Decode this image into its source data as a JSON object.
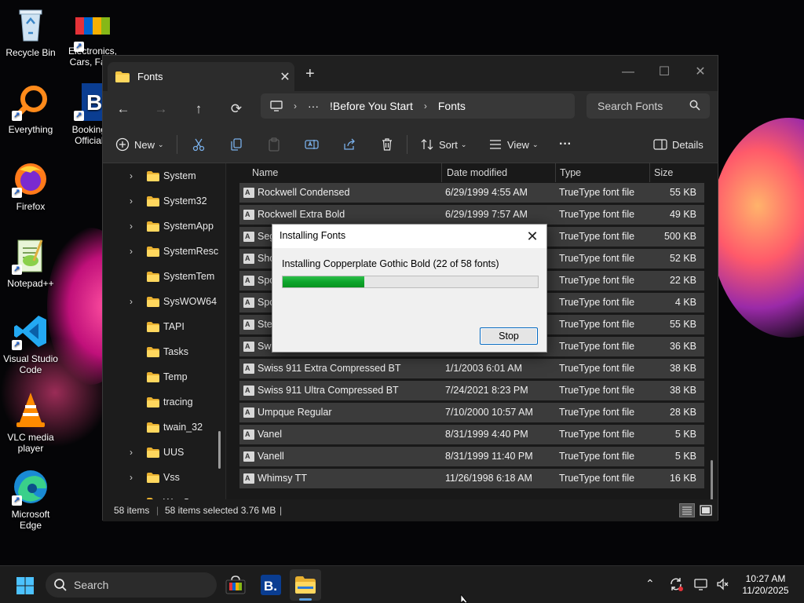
{
  "desktop": {
    "icons": [
      {
        "label": "Recycle Bin"
      },
      {
        "label": "Electronics, Cars, Fash"
      },
      {
        "label": "Everything"
      },
      {
        "label": "Booking.c Official s"
      },
      {
        "label": "Firefox"
      },
      {
        "label": "Notepad++"
      },
      {
        "label": "Visual Studio Code"
      },
      {
        "label": "VLC media player"
      },
      {
        "label": "Microsoft Edge"
      }
    ]
  },
  "explorer": {
    "tab_title": "Fonts",
    "new_tab": "+",
    "address": {
      "more": "···",
      "crumbs": [
        "!Before You Start",
        "Fonts"
      ]
    },
    "search_placeholder": "Search Fonts",
    "toolbar": {
      "new_label": "New",
      "sort_label": "Sort",
      "view_label": "View",
      "more_label": "···",
      "details_label": "Details"
    },
    "nav_items": [
      {
        "label": "System",
        "expandable": true
      },
      {
        "label": "System32",
        "expandable": true
      },
      {
        "label": "SystemApp",
        "expandable": true
      },
      {
        "label": "SystemResc",
        "expandable": true
      },
      {
        "label": "SystemTem",
        "expandable": false
      },
      {
        "label": "SysWOW64",
        "expandable": true
      },
      {
        "label": "TAPI",
        "expandable": false
      },
      {
        "label": "Tasks",
        "expandable": false
      },
      {
        "label": "Temp",
        "expandable": false
      },
      {
        "label": "tracing",
        "expandable": false
      },
      {
        "label": "twain_32",
        "expandable": false
      },
      {
        "label": "UUS",
        "expandable": true
      },
      {
        "label": "Vss",
        "expandable": true
      },
      {
        "label": "WaaS",
        "expandable": true
      }
    ],
    "columns": {
      "name": "Name",
      "date": "Date modified",
      "type": "Type",
      "size": "Size"
    },
    "rows": [
      {
        "name": "Rockwell Condensed",
        "date": "6/29/1999 4:55 AM",
        "type": "TrueType font file",
        "size": "55 KB"
      },
      {
        "name": "Rockwell Extra Bold",
        "date": "6/29/1999 7:57 AM",
        "type": "TrueType font file",
        "size": "49 KB"
      },
      {
        "name": "Seg",
        "date": "",
        "type": "TrueType font file",
        "size": "500 KB"
      },
      {
        "name": "Sho",
        "date": "",
        "type": "TrueType font file",
        "size": "52 KB"
      },
      {
        "name": "Spo",
        "date": "",
        "type": "TrueType font file",
        "size": "22 KB"
      },
      {
        "name": "Spo",
        "date": "",
        "type": "TrueType font file",
        "size": "4 KB"
      },
      {
        "name": "Ster",
        "date": "",
        "type": "TrueType font file",
        "size": "55 KB"
      },
      {
        "name": "Swi",
        "date": "",
        "type": "TrueType font file",
        "size": "36 KB"
      },
      {
        "name": "Swiss 911 Extra Compressed BT",
        "date": "1/1/2003 6:01 AM",
        "type": "TrueType font file",
        "size": "38 KB"
      },
      {
        "name": "Swiss 911 Ultra Compressed BT",
        "date": "7/24/2021 8:23 PM",
        "type": "TrueType font file",
        "size": "38 KB"
      },
      {
        "name": "Umpque Regular",
        "date": "7/10/2000 10:57 AM",
        "type": "TrueType font file",
        "size": "28 KB"
      },
      {
        "name": "Vanel",
        "date": "8/31/1999 4:40 PM",
        "type": "TrueType font file",
        "size": "5 KB"
      },
      {
        "name": "Vanell",
        "date": "8/31/1999 11:40 PM",
        "type": "TrueType font file",
        "size": "5 KB"
      },
      {
        "name": "Whimsy TT",
        "date": "11/26/1998 6:18 AM",
        "type": "TrueType font file",
        "size": "16 KB"
      }
    ],
    "status": {
      "items": "58 items",
      "selected": "58 items selected 3.76 MB"
    }
  },
  "dialog": {
    "title": "Installing Fonts",
    "message": "Installing Copperplate Gothic Bold (22 of 58 fonts)",
    "progress": 0.32,
    "stop_label": "Stop"
  },
  "taskbar": {
    "search_placeholder": "Search",
    "time": "10:27 AM",
    "date": "11/20/2025"
  }
}
